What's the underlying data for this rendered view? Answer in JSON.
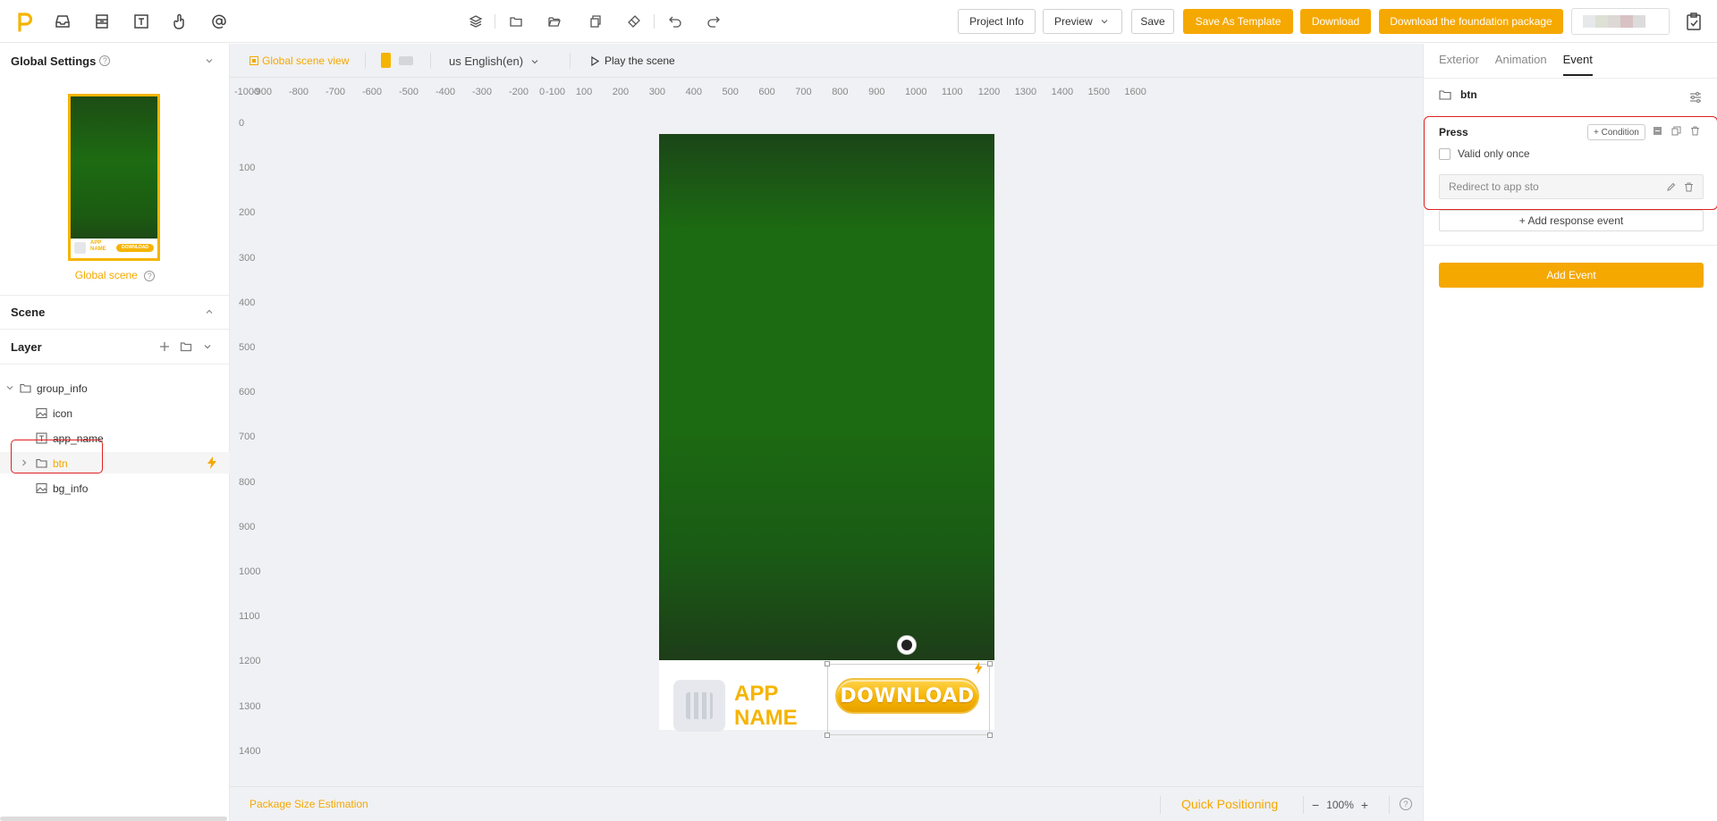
{
  "toolbar": {
    "project_info": "Project Info",
    "preview": "Preview",
    "save": "Save",
    "save_as_template": "Save As Template",
    "download": "Download",
    "download_foundation": "Download the foundation package",
    "accent_color": "#f5a800"
  },
  "left_panel": {
    "global_settings": "Global Settings",
    "global_scene": "Global scene",
    "scene": "Scene",
    "layer": "Layer",
    "thumb_app_name": "APP NAME",
    "thumb_download": "DOWNLOAD",
    "tree": [
      {
        "label": "group_info",
        "icon": "folder-icon",
        "expanded": true
      },
      {
        "label": "icon",
        "icon": "image-icon"
      },
      {
        "label": "app_name",
        "icon": "text-icon"
      },
      {
        "label": "btn",
        "icon": "folder-icon",
        "selected": true
      },
      {
        "label": "bg_info",
        "icon": "image-icon"
      }
    ]
  },
  "canvas": {
    "global_scene_view": "Global scene view",
    "language": "us English(en)",
    "play_scene": "Play the scene",
    "ruler_h": [
      "-1000",
      "-900",
      "-800",
      "-700",
      "-600",
      "-500",
      "-400",
      "-300",
      "-200",
      "-100",
      "0",
      "100",
      "200",
      "300",
      "400",
      "500",
      "600",
      "700",
      "800",
      "900",
      "1000",
      "1100",
      "1200",
      "1300",
      "1400",
      "1500",
      "1600"
    ],
    "ruler_v": [
      "0",
      "100",
      "200",
      "300",
      "400",
      "500",
      "600",
      "700",
      "800",
      "900",
      "1000",
      "1100",
      "1200",
      "1300",
      "1400"
    ],
    "app_name_line1": "APP",
    "app_name_line2": "NAME",
    "download_btn": "DOWNLOAD",
    "package_size": "Package Size Estimation",
    "quick_positioning": "Quick Positioning",
    "zoom": "100%",
    "zoom_minus": "−",
    "zoom_plus": "+"
  },
  "right_panel": {
    "tabs": [
      "Exterior",
      "Animation",
      "Event"
    ],
    "active_tab": "Event",
    "object_name": "btn",
    "press": "Press",
    "condition": "+ Condition",
    "valid_once": "Valid only once",
    "redirect": "Redirect to app sto",
    "add_response": "+ Add response event",
    "add_event": "Add Event"
  }
}
